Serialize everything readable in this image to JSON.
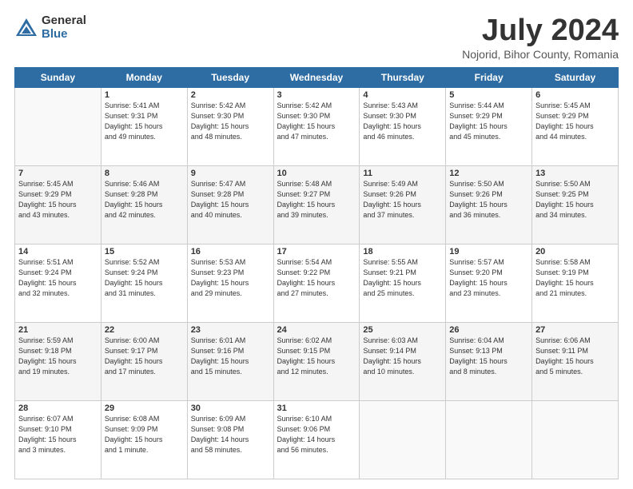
{
  "logo": {
    "general": "General",
    "blue": "Blue"
  },
  "title": "July 2024",
  "subtitle": "Nojorid, Bihor County, Romania",
  "days_of_week": [
    "Sunday",
    "Monday",
    "Tuesday",
    "Wednesday",
    "Thursday",
    "Friday",
    "Saturday"
  ],
  "weeks": [
    [
      {
        "day": "",
        "info": ""
      },
      {
        "day": "1",
        "info": "Sunrise: 5:41 AM\nSunset: 9:31 PM\nDaylight: 15 hours\nand 49 minutes."
      },
      {
        "day": "2",
        "info": "Sunrise: 5:42 AM\nSunset: 9:30 PM\nDaylight: 15 hours\nand 48 minutes."
      },
      {
        "day": "3",
        "info": "Sunrise: 5:42 AM\nSunset: 9:30 PM\nDaylight: 15 hours\nand 47 minutes."
      },
      {
        "day": "4",
        "info": "Sunrise: 5:43 AM\nSunset: 9:30 PM\nDaylight: 15 hours\nand 46 minutes."
      },
      {
        "day": "5",
        "info": "Sunrise: 5:44 AM\nSunset: 9:29 PM\nDaylight: 15 hours\nand 45 minutes."
      },
      {
        "day": "6",
        "info": "Sunrise: 5:45 AM\nSunset: 9:29 PM\nDaylight: 15 hours\nand 44 minutes."
      }
    ],
    [
      {
        "day": "7",
        "info": "Sunrise: 5:45 AM\nSunset: 9:29 PM\nDaylight: 15 hours\nand 43 minutes."
      },
      {
        "day": "8",
        "info": "Sunrise: 5:46 AM\nSunset: 9:28 PM\nDaylight: 15 hours\nand 42 minutes."
      },
      {
        "day": "9",
        "info": "Sunrise: 5:47 AM\nSunset: 9:28 PM\nDaylight: 15 hours\nand 40 minutes."
      },
      {
        "day": "10",
        "info": "Sunrise: 5:48 AM\nSunset: 9:27 PM\nDaylight: 15 hours\nand 39 minutes."
      },
      {
        "day": "11",
        "info": "Sunrise: 5:49 AM\nSunset: 9:26 PM\nDaylight: 15 hours\nand 37 minutes."
      },
      {
        "day": "12",
        "info": "Sunrise: 5:50 AM\nSunset: 9:26 PM\nDaylight: 15 hours\nand 36 minutes."
      },
      {
        "day": "13",
        "info": "Sunrise: 5:50 AM\nSunset: 9:25 PM\nDaylight: 15 hours\nand 34 minutes."
      }
    ],
    [
      {
        "day": "14",
        "info": "Sunrise: 5:51 AM\nSunset: 9:24 PM\nDaylight: 15 hours\nand 32 minutes."
      },
      {
        "day": "15",
        "info": "Sunrise: 5:52 AM\nSunset: 9:24 PM\nDaylight: 15 hours\nand 31 minutes."
      },
      {
        "day": "16",
        "info": "Sunrise: 5:53 AM\nSunset: 9:23 PM\nDaylight: 15 hours\nand 29 minutes."
      },
      {
        "day": "17",
        "info": "Sunrise: 5:54 AM\nSunset: 9:22 PM\nDaylight: 15 hours\nand 27 minutes."
      },
      {
        "day": "18",
        "info": "Sunrise: 5:55 AM\nSunset: 9:21 PM\nDaylight: 15 hours\nand 25 minutes."
      },
      {
        "day": "19",
        "info": "Sunrise: 5:57 AM\nSunset: 9:20 PM\nDaylight: 15 hours\nand 23 minutes."
      },
      {
        "day": "20",
        "info": "Sunrise: 5:58 AM\nSunset: 9:19 PM\nDaylight: 15 hours\nand 21 minutes."
      }
    ],
    [
      {
        "day": "21",
        "info": "Sunrise: 5:59 AM\nSunset: 9:18 PM\nDaylight: 15 hours\nand 19 minutes."
      },
      {
        "day": "22",
        "info": "Sunrise: 6:00 AM\nSunset: 9:17 PM\nDaylight: 15 hours\nand 17 minutes."
      },
      {
        "day": "23",
        "info": "Sunrise: 6:01 AM\nSunset: 9:16 PM\nDaylight: 15 hours\nand 15 minutes."
      },
      {
        "day": "24",
        "info": "Sunrise: 6:02 AM\nSunset: 9:15 PM\nDaylight: 15 hours\nand 12 minutes."
      },
      {
        "day": "25",
        "info": "Sunrise: 6:03 AM\nSunset: 9:14 PM\nDaylight: 15 hours\nand 10 minutes."
      },
      {
        "day": "26",
        "info": "Sunrise: 6:04 AM\nSunset: 9:13 PM\nDaylight: 15 hours\nand 8 minutes."
      },
      {
        "day": "27",
        "info": "Sunrise: 6:06 AM\nSunset: 9:11 PM\nDaylight: 15 hours\nand 5 minutes."
      }
    ],
    [
      {
        "day": "28",
        "info": "Sunrise: 6:07 AM\nSunset: 9:10 PM\nDaylight: 15 hours\nand 3 minutes."
      },
      {
        "day": "29",
        "info": "Sunrise: 6:08 AM\nSunset: 9:09 PM\nDaylight: 15 hours\nand 1 minute."
      },
      {
        "day": "30",
        "info": "Sunrise: 6:09 AM\nSunset: 9:08 PM\nDaylight: 14 hours\nand 58 minutes."
      },
      {
        "day": "31",
        "info": "Sunrise: 6:10 AM\nSunset: 9:06 PM\nDaylight: 14 hours\nand 56 minutes."
      },
      {
        "day": "",
        "info": ""
      },
      {
        "day": "",
        "info": ""
      },
      {
        "day": "",
        "info": ""
      }
    ]
  ]
}
